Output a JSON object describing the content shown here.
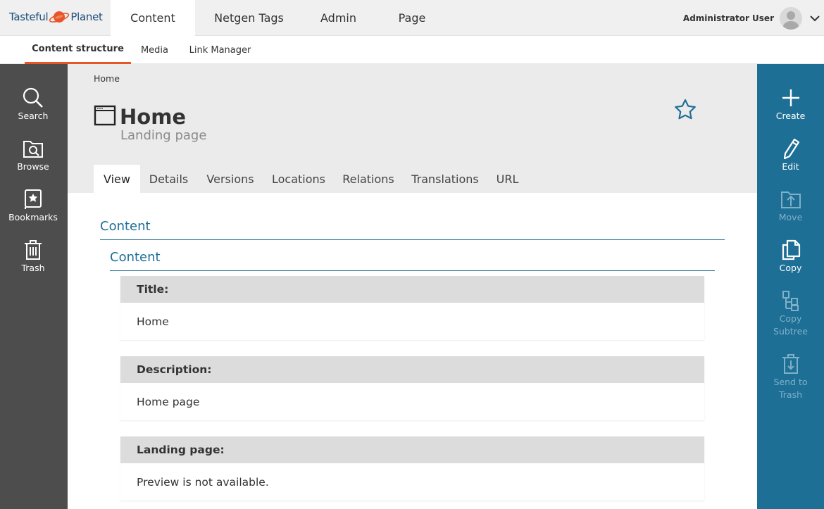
{
  "brand": {
    "part1": "Tasteful",
    "part2": "Planet"
  },
  "main_nav": [
    {
      "label": "Content"
    },
    {
      "label": "Netgen Tags"
    },
    {
      "label": "Admin"
    },
    {
      "label": "Page"
    }
  ],
  "user": {
    "name": "Administrator User"
  },
  "sub_nav": [
    {
      "label": "Content structure"
    },
    {
      "label": "Media"
    },
    {
      "label": "Link Manager"
    }
  ],
  "left_sidebar": [
    {
      "label": "Search",
      "icon": "search-icon"
    },
    {
      "label": "Browse",
      "icon": "browse-icon"
    },
    {
      "label": "Bookmarks",
      "icon": "bookmarks-icon"
    },
    {
      "label": "Trash",
      "icon": "trash-icon"
    }
  ],
  "right_sidebar": [
    {
      "label": "Create",
      "icon": "plus-icon",
      "enabled": true
    },
    {
      "label": "Edit",
      "icon": "pencil-icon",
      "enabled": true
    },
    {
      "label": "Move",
      "icon": "move-icon",
      "enabled": false
    },
    {
      "label": "Copy",
      "icon": "copy-icon",
      "enabled": true
    },
    {
      "label": "Copy Subtree",
      "icon": "copy-subtree-icon",
      "enabled": false
    },
    {
      "label": "Send to Trash",
      "icon": "send-to-trash-icon",
      "enabled": false
    }
  ],
  "breadcrumb": "Home",
  "page": {
    "title": "Home",
    "subtitle": "Landing page"
  },
  "tabs": [
    {
      "label": "View"
    },
    {
      "label": "Details"
    },
    {
      "label": "Versions"
    },
    {
      "label": "Locations"
    },
    {
      "label": "Relations"
    },
    {
      "label": "Translations"
    },
    {
      "label": "URL"
    }
  ],
  "content": {
    "section_title": "Content",
    "group_title": "Content",
    "fields": [
      {
        "label": "Title:",
        "value": "Home"
      },
      {
        "label": "Description:",
        "value": "Home page"
      },
      {
        "label": "Landing page:",
        "value": "Preview is not available."
      }
    ]
  },
  "colors": {
    "accent": "#1e6f96",
    "sidebar": "#4d4d4d",
    "active_tab_underline": "#e8552a"
  }
}
